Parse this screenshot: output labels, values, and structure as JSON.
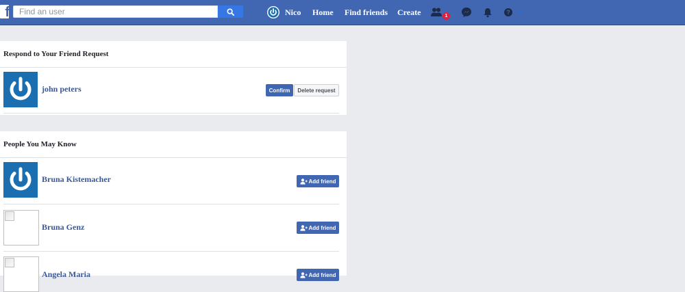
{
  "topbar": {
    "logo": "f",
    "search": {
      "placeholder": "Find an user",
      "value": ""
    },
    "nav": {
      "profile_name": "Nico",
      "home": "Home",
      "find_friends": "Find friends",
      "create": "Create"
    },
    "notification_badge": "1"
  },
  "friend_requests": {
    "header": "Respond to Your Friend Request",
    "items": [
      {
        "name": "john peters",
        "confirm_label": "Confirm",
        "delete_label": "Delete request"
      }
    ]
  },
  "people_you_may_know": {
    "header": "People You May Know",
    "items": [
      {
        "name": "Bruna Kistemacher",
        "button_label": "Add friend"
      },
      {
        "name": "Bruna Genz",
        "button_label": "Add friend"
      },
      {
        "name": "Angela Maria",
        "button_label": "Add friend"
      }
    ]
  },
  "colors": {
    "brand": "#4267b2",
    "background": "#e9ebee",
    "link": "#385898",
    "badge": "#e41e3f"
  }
}
